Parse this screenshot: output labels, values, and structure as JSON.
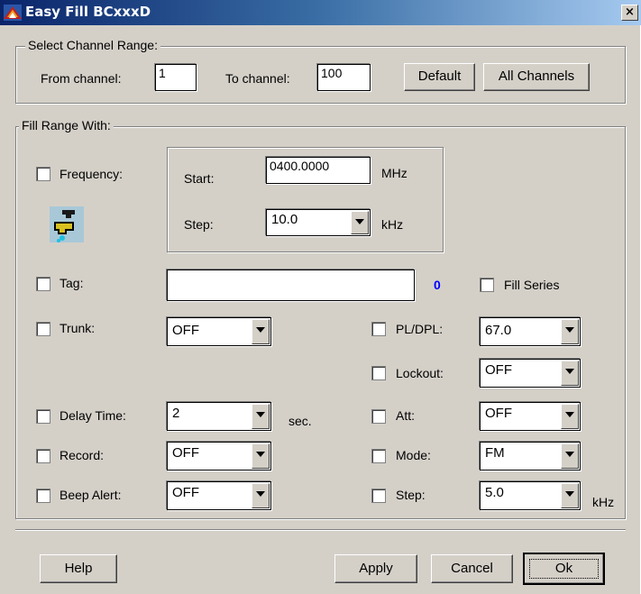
{
  "window": {
    "title": "Easy Fill BCxxxD",
    "close_label": "×"
  },
  "channel_range": {
    "group_label": "Select Channel Range:",
    "from_label": "From channel:",
    "from_value": "1",
    "to_label": "To channel:",
    "to_value": "100",
    "default_button": "Default",
    "all_channels_button": "All Channels"
  },
  "fill_range": {
    "group_label": "Fill Range With:",
    "frequency": {
      "checkbox_label": "Frequency:",
      "start_label": "Start:",
      "start_value": "0400.0000",
      "start_unit": "MHz",
      "step_label": "Step:",
      "step_value": "10.0",
      "step_unit": "kHz"
    },
    "tag": {
      "checkbox_label": "Tag:",
      "value": "",
      "count": "0"
    },
    "fill_series_label": "Fill Series",
    "trunk": {
      "label": "Trunk:",
      "value": "OFF"
    },
    "pl_dpl": {
      "label": "PL/DPL:",
      "value": "67.0"
    },
    "lockout": {
      "label": "Lockout:",
      "value": "OFF"
    },
    "delay_time": {
      "label": "Delay Time:",
      "value": "2",
      "unit": "sec."
    },
    "att": {
      "label": "Att:",
      "value": "OFF"
    },
    "record": {
      "label": "Record:",
      "value": "OFF"
    },
    "mode": {
      "label": "Mode:",
      "value": "FM"
    },
    "beep_alert": {
      "label": "Beep Alert:",
      "value": "OFF"
    },
    "step": {
      "label": "Step:",
      "value": "5.0",
      "unit": "kHz"
    }
  },
  "footer": {
    "help": "Help",
    "apply": "Apply",
    "cancel": "Cancel",
    "ok": "Ok"
  },
  "colors": {
    "tag_count": "#0000ff",
    "title_start": "#0a246a",
    "title_end": "#a6caf0"
  }
}
